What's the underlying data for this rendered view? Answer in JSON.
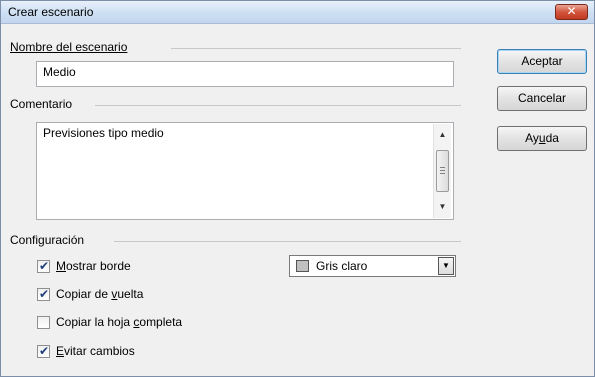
{
  "window": {
    "title": "Crear escenario",
    "close_glyph": "✕"
  },
  "name_section": {
    "label": "Nombre del escenario",
    "value": "Medio"
  },
  "comment_section": {
    "label": "Comentario",
    "value": "Previsiones tipo medio"
  },
  "config_section": {
    "label": "Configuración",
    "options": [
      {
        "label_pre": "",
        "key": "M",
        "label_post": "ostrar borde",
        "checked": true
      },
      {
        "label_pre": "Copiar de ",
        "key": "v",
        "label_post": "uelta",
        "checked": true
      },
      {
        "label_pre": "Copiar la hoja ",
        "key": "c",
        "label_post": "ompleta",
        "checked": false
      },
      {
        "label_pre": "",
        "key": "E",
        "label_post": "vitar cambios",
        "checked": true
      }
    ],
    "border_color": {
      "label": "Gris claro",
      "hex": "#c0c0c0"
    }
  },
  "buttons": {
    "accept": "Aceptar",
    "cancel": "Cancelar",
    "help_pre": "Ay",
    "help_key": "u",
    "help_post": "da"
  },
  "glyphs": {
    "check": "✔",
    "up": "▲",
    "down": "▼"
  }
}
